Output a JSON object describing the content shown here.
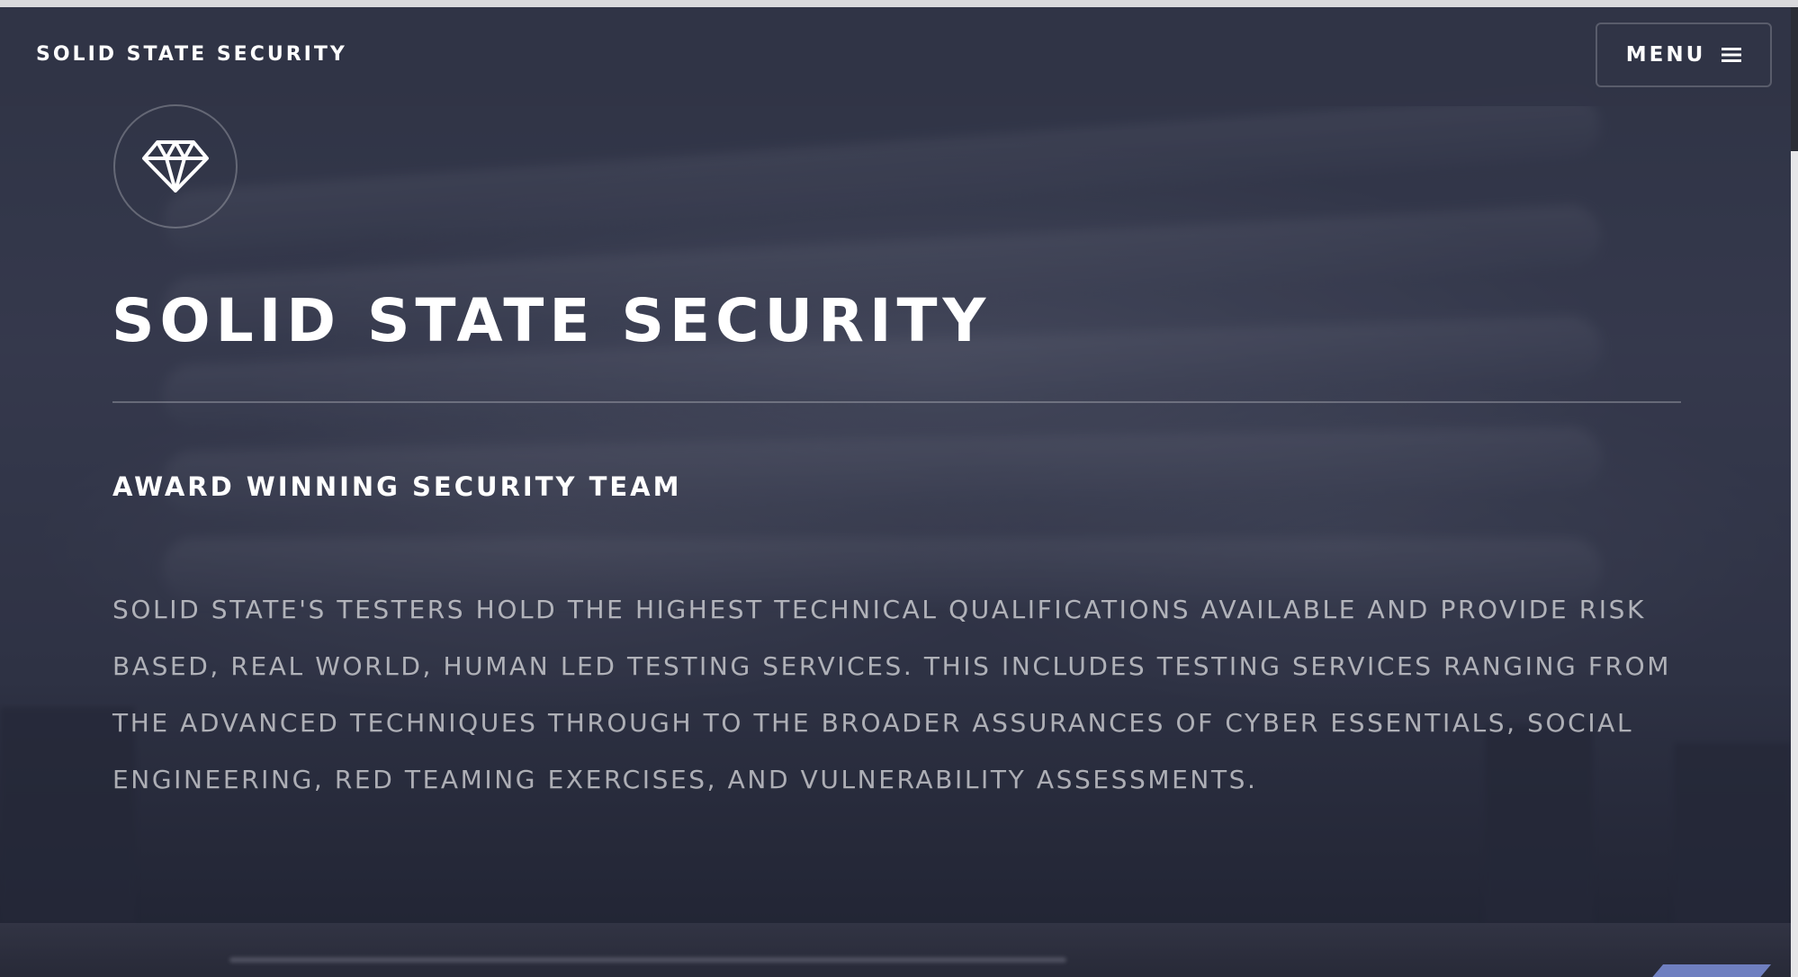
{
  "header": {
    "brand": "SOLID STATE SECURITY",
    "menu_label": "MENU",
    "menu_icon": "hamburger-icon"
  },
  "hero": {
    "logo_icon": "diamond-icon",
    "title": "SOLID STATE SECURITY",
    "subtitle": "AWARD WINNING SECURITY TEAM",
    "body": "SOLID STATE'S TESTERS HOLD THE HIGHEST TECHNICAL QUALIFICATIONS AVAILABLE AND PROVIDE RISK BASED, REAL WORLD, HUMAN LED TESTING SERVICES. THIS INCLUDES TESTING SERVICES RANGING FROM THE ADVANCED TECHNIQUES THROUGH TO THE BROADER ASSURANCES OF CYBER ESSENTIALS, SOCIAL ENGINEERING, RED TEAMING EXERCISES, AND VULNERABILITY ASSESSMENTS."
  },
  "colors": {
    "header_bg": "#313446",
    "overlay": "#24283a",
    "accent": "#6f7fc0",
    "text": "#ffffff"
  }
}
